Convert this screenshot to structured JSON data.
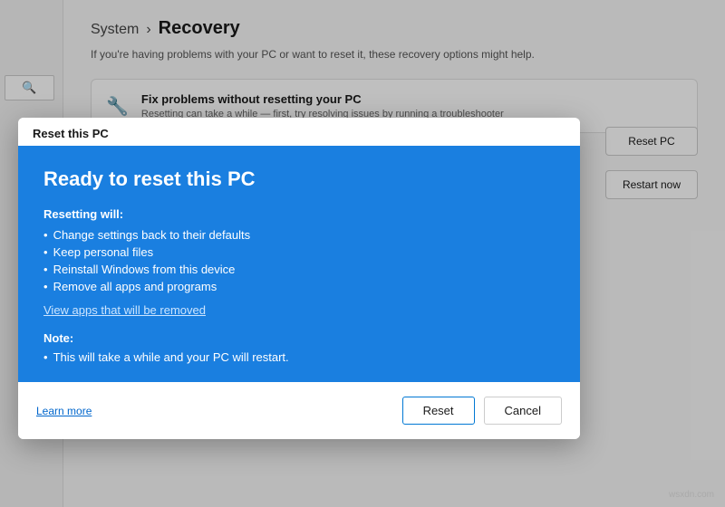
{
  "breadcrumb": {
    "system": "System",
    "separator": "›",
    "recovery": "Recovery"
  },
  "subtitle": "If you're having problems with your PC or want to reset it, these recovery options might help.",
  "fix_section": {
    "icon": "🔧",
    "title": "Fix problems without resetting your PC",
    "description": "Resetting can take a while — first, try resolving issues by running a troubleshooter"
  },
  "right_buttons": {
    "reset_pc": "Reset PC",
    "restart_now": "Restart now"
  },
  "modal": {
    "title_bar": "Reset this PC",
    "heading": "Ready to reset this PC",
    "resetting_will_label": "Resetting will:",
    "bullets": [
      "Change settings back to their defaults",
      "Keep personal files",
      "Reinstall Windows from this device",
      "Remove all apps and programs"
    ],
    "view_apps_link": "View apps that will be removed",
    "note_label": "Note:",
    "note_bullets": [
      "This will take a while and your PC will restart."
    ],
    "learn_more": "Learn more",
    "reset_button": "Reset",
    "cancel_button": "Cancel"
  },
  "watermark": "wsxdn.com"
}
